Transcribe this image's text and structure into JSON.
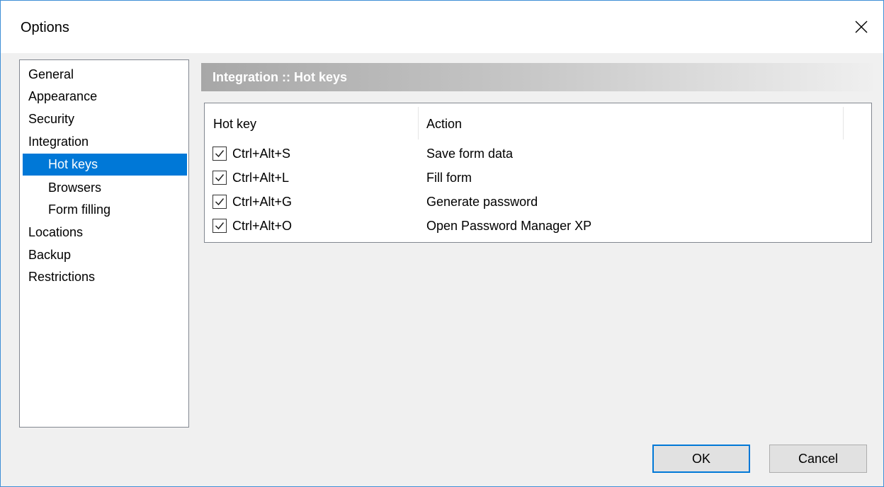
{
  "window": {
    "title": "Options"
  },
  "tree": {
    "items": [
      {
        "label": "General"
      },
      {
        "label": "Appearance"
      },
      {
        "label": "Security"
      },
      {
        "label": "Integration"
      },
      {
        "label": "Hot keys",
        "selected": true
      },
      {
        "label": "Browsers"
      },
      {
        "label": "Form filling"
      },
      {
        "label": "Locations"
      },
      {
        "label": "Backup"
      },
      {
        "label": "Restrictions"
      }
    ]
  },
  "section": {
    "title": "Integration :: Hot keys"
  },
  "hotkeys": {
    "columns": [
      "Hot key",
      "Action"
    ],
    "rows": [
      {
        "checked": true,
        "key": "Ctrl+Alt+S",
        "action": "Save form data"
      },
      {
        "checked": true,
        "key": "Ctrl+Alt+L",
        "action": "Fill form"
      },
      {
        "checked": true,
        "key": "Ctrl+Alt+G",
        "action": "Generate password"
      },
      {
        "checked": true,
        "key": "Ctrl+Alt+O",
        "action": "Open Password Manager XP"
      }
    ]
  },
  "buttons": {
    "ok": "OK",
    "cancel": "Cancel"
  },
  "colors": {
    "selection": "#0078d7",
    "window_border": "#3f8fd6"
  },
  "icons": {
    "close": "close-icon",
    "check": "check-icon"
  }
}
